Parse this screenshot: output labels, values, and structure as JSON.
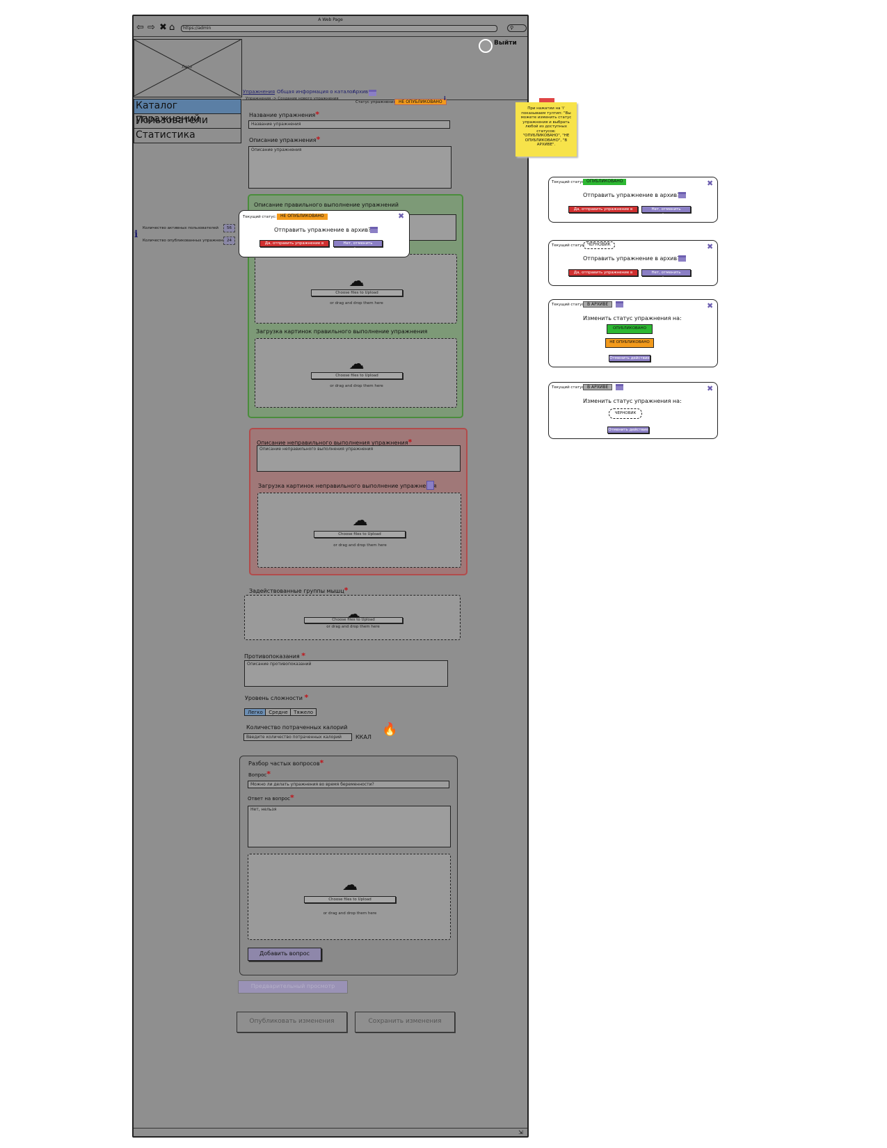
{
  "window": {
    "title": "A Web Page",
    "url": "https://admin",
    "search_icon": "search-icon"
  },
  "header": {
    "logo_label": "Лого",
    "user_label": "Выйти"
  },
  "tabs": [
    "Упражнения",
    "Общая информация о каталог",
    "Архив"
  ],
  "sidebar": {
    "items": [
      "Каталог упражнений",
      "Пользователи",
      "Статистика"
    ]
  },
  "stats": {
    "active_users_label": "Количество активных пользователей",
    "active_users_value": "56",
    "published_label": "Количество опубликованных упражнений",
    "published_value": "24"
  },
  "breadcrumb": "Упражнения -> Создание нового упражнения",
  "status": {
    "label": "Статус упражнения",
    "value": "НЕ ОПУБЛИКОВАНО"
  },
  "form": {
    "name_label": "Название упражнения",
    "name_placeholder": "Название упражнения",
    "desc_label": "Описание упражнения",
    "desc_placeholder": "Описание упражнения",
    "correct_label": "Описание правильного выполнение упражнений",
    "correct_images_label": "Загрузка картинок правильного выполнение упражнения",
    "incorrect_label": "Описание неправильного выполнения упражнения",
    "incorrect_placeholder": "Описание неправильного выполнения упражнения",
    "incorrect_images_label": "Загрузка картинок неправильного выполнение упражнения",
    "muscles_label": "Задействованные группы мышц",
    "contra_label": "Противопоказания",
    "contra_placeholder": "Описание противопоказаний",
    "difficulty_label": "Уровень сложности",
    "difficulty_options": [
      "Легко",
      "Средне",
      "Тяжело"
    ],
    "calories_label": "Количество потраченных калорий",
    "calories_placeholder": "Введите количество потраченных калорий",
    "calories_unit": "ККАЛ"
  },
  "upload": {
    "button": "Choose files to Upload",
    "hint": "or drag and drop them here"
  },
  "faq": {
    "title": "Разбор частых вопросов",
    "question_label": "Вопрос",
    "question_value": "Можно ли делать упражнения во время беременности?",
    "answer_label": "Ответ на вопрос",
    "answer_value": "Нет, нельзя",
    "add_button": "Добавить вопрос"
  },
  "actions": {
    "preview": "Предварительный просмотр",
    "publish": "Опубликовать изменения",
    "save": "Сохранить изменения"
  },
  "sticky_note": "При нажатии на 'i' показываем тултип: \"Вы можете изменить статус упражнения и выбрать любой из доступных статусов: \"ОПУБЛИКОВАНО\", \"НЕ ОПУБЛИКОВАНО\", \"В АРХИВЕ\".",
  "modal_main": {
    "current_label": "Текущий статус:",
    "current_value": "НЕ ОПУБЛИКОВАНО",
    "question": "Отправить упражнение в архив?",
    "yes": "Да, отправить упражнение в архив",
    "no": "Нет, отменить действие"
  },
  "variants": [
    {
      "current_label": "Текущий статус:",
      "current_value": "ОПУБЛИКОВАНО",
      "question": "Отправить упражнение в архив?",
      "yes": "Да, отправить упражнение в архив",
      "no": "Нет, отменить действие"
    },
    {
      "current_label": "Текущий статус:",
      "current_value": "ЧЕРНОВИК",
      "question": "Отправить упражнение в архив?",
      "yes": "Да, отправить упражнение в архив",
      "no": "Нет, отменить действие"
    },
    {
      "current_label": "Текущий статус:",
      "current_value": "В АРХИВЕ",
      "question": "Изменить статус упражнения на:",
      "option_a": "ОПУБЛИКОВАНО",
      "option_b": "НЕ ОПУБЛИКОВАНО",
      "cancel": "Отменить действие"
    },
    {
      "current_label": "Текущий статус:",
      "current_value": "В АРХИВЕ",
      "question": "Изменить статус упражнения на:",
      "option_a": "ЧЕРНОВИК",
      "cancel": "Отменить действие"
    }
  ],
  "colors": {
    "published": "#2db832",
    "unpublished": "#f29a1c",
    "archived": "#a8a8a8",
    "danger": "#d03030",
    "accent": "#8b7fc5"
  }
}
